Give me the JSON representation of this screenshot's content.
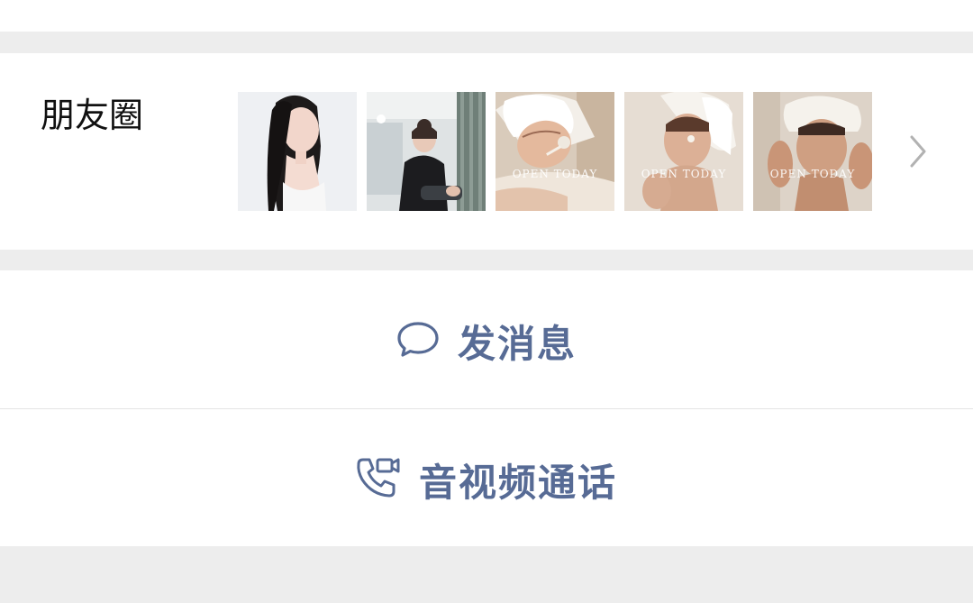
{
  "moments": {
    "label": "朋友圈",
    "thumbnails": [
      {
        "name": "thumbnail-portrait",
        "caption": ""
      },
      {
        "name": "thumbnail-salon-treatment",
        "caption": ""
      },
      {
        "name": "thumbnail-facial-mask",
        "caption": "OPEN TODAY"
      },
      {
        "name": "thumbnail-face-cream",
        "caption": "OPEN TODAY"
      },
      {
        "name": "thumbnail-skin-care",
        "caption": "OPEN TODAY"
      }
    ],
    "more_icon": "chevron-right-icon"
  },
  "actions": {
    "message": {
      "label": "发消息",
      "icon": "chat-bubble-icon"
    },
    "call": {
      "label": "音视频通话",
      "icon": "phone-video-icon"
    }
  },
  "colors": {
    "background": "#ededed",
    "card": "#ffffff",
    "link": "#576b95",
    "text": "#111111",
    "chevron": "#b2b2b2"
  }
}
